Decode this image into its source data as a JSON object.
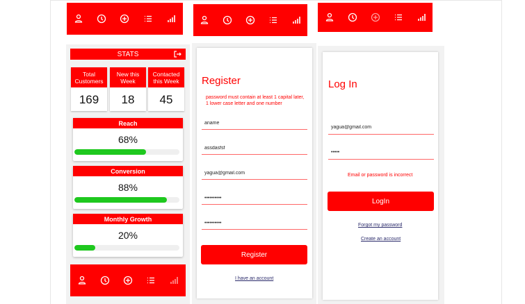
{
  "nav": {
    "icons": [
      "person-icon",
      "clock-icon",
      "plus-circle-icon",
      "list-icon",
      "chart-icon"
    ]
  },
  "stats": {
    "title": "STATS",
    "cards": [
      {
        "label": "Total Customers",
        "value": "169"
      },
      {
        "label": "New this Week",
        "value": "18"
      },
      {
        "label": "Contacted this Week",
        "value": "45"
      }
    ],
    "metrics": [
      {
        "label": "Reach",
        "value": "68%",
        "fraction": 0.68
      },
      {
        "label": "Conversion",
        "value": "88%",
        "fraction": 0.88
      },
      {
        "label": "Monthly Growth",
        "value": "20%",
        "fraction": 0.2
      }
    ]
  },
  "register": {
    "title": "Register",
    "hint": "password must contain at least 1 capital later, 1 lower case letter and one number",
    "fields": [
      "aname",
      "assdasfsf",
      "yagua@gmail.com",
      "••••••••••",
      "••••••••••"
    ],
    "button": "Register",
    "link": "I have an account"
  },
  "login": {
    "title": "Log In",
    "fields": [
      "yagua@gmail.com",
      "•••••"
    ],
    "error": "Email or password is incorrect",
    "button": "LogIn",
    "forgot": "Forgot my password",
    "create": "Create an account"
  },
  "colors": {
    "accent": "#ff0000",
    "progress": "#1ec81e"
  }
}
